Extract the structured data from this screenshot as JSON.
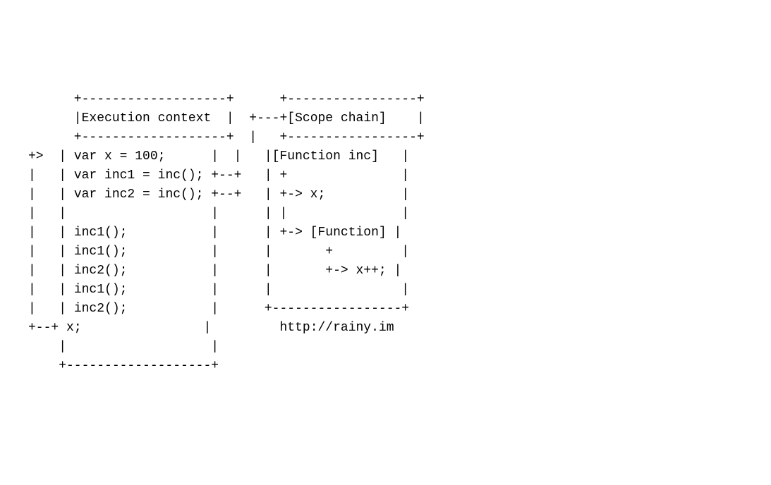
{
  "diagram": {
    "left_title": "Execution context",
    "right_title": "[Scope chain]",
    "exec_lines": {
      "l1": " var x = 100;",
      "l2": " var inc1 = inc();",
      "l3": " var inc2 = inc();",
      "l4": "",
      "l5": " inc1();",
      "l6": " inc1();",
      "l7": " inc2();",
      "l8": " inc1();",
      "l9": " inc2();",
      "l10": " x;"
    },
    "scope_lines": {
      "s1": "[Function inc]",
      "s2": " +",
      "s3": " +-> x;",
      "s4": " |",
      "s5": " +-> [Function]",
      "s6": "       +",
      "s7": "       +-> x++;",
      "s8": ""
    },
    "footer": "http://rainy.im"
  }
}
